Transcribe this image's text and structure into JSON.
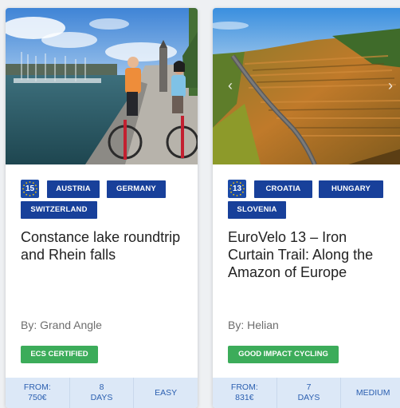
{
  "cards": [
    {
      "eurovelo_route": "15",
      "countries": [
        "AUSTRIA",
        "GERMANY",
        "SWITZERLAND"
      ],
      "title": "Constance lake roundtrip and Rhein falls",
      "author": "By: Grand Angle",
      "certification": "ECS CERTIFIED",
      "price_label": "FROM:",
      "price": "750€",
      "duration_value": "8",
      "duration_unit": "DAYS",
      "difficulty": "EASY",
      "photo": "cyclists-on-lakeside-pier"
    },
    {
      "eurovelo_route": "13",
      "countries": [
        "CROATIA",
        "HUNGARY",
        "SLOVENIA"
      ],
      "title": "EuroVelo 13 – Iron Curtain Trail: Along the Amazon of Europe",
      "author": "By: Helian",
      "certification": "GOOD IMPACT CYCLING",
      "price_label": "FROM:",
      "price": "831€",
      "duration_value": "7",
      "duration_unit": "DAYS",
      "difficulty": "MEDIUM",
      "photo": "vineyard-road-aerial",
      "carousel_prev": "‹",
      "carousel_next": "›"
    }
  ],
  "colors": {
    "tag_blue": "#18409a",
    "badge_green": "#3cac5a",
    "info_bar": "#dce8f7",
    "info_text": "#2b5fb0"
  }
}
